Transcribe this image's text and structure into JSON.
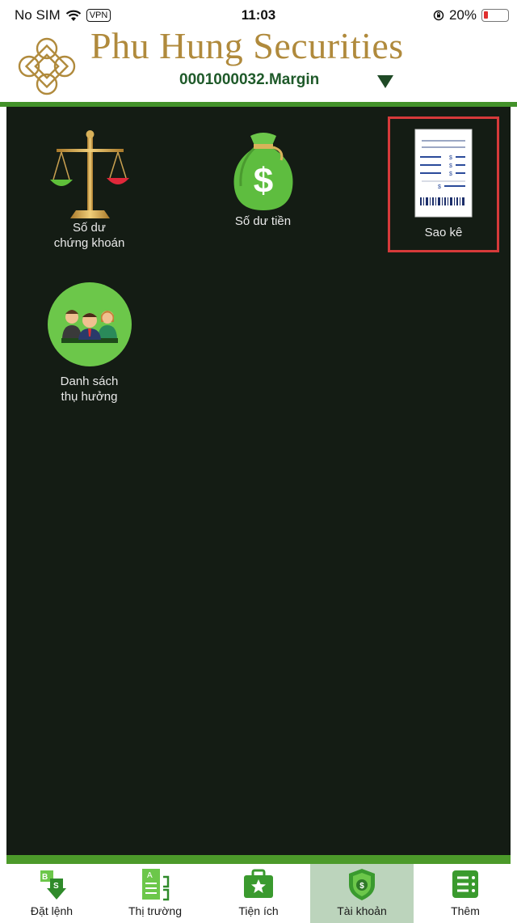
{
  "status_bar": {
    "carrier": "No SIM",
    "vpn": "VPN",
    "time": "11:03",
    "battery": "20%",
    "battery_level": 0.2
  },
  "header": {
    "brand": "Phu Hung Securities",
    "account": "0001000032.Margin"
  },
  "menu": [
    {
      "label_line1": "Số dư",
      "label_line2": "chứng khoán",
      "icon": "scales-icon"
    },
    {
      "label_line1": "Số dư tiền",
      "label_line2": "",
      "icon": "money-bag-icon"
    },
    {
      "label_line1": "Sao kê",
      "label_line2": "",
      "icon": "statement-receipt-icon",
      "highlighted": true
    },
    {
      "label_line1": "Danh sách",
      "label_line2": "thụ hưởng",
      "icon": "beneficiaries-icon"
    }
  ],
  "tabs": [
    {
      "label": "Đặt lệnh",
      "icon": "buy-sell-icon"
    },
    {
      "label": "Thị trường",
      "icon": "market-icon"
    },
    {
      "label": "Tiện ích",
      "icon": "utilities-icon"
    },
    {
      "label": "Tài khoản",
      "icon": "account-shield-icon",
      "active": true
    },
    {
      "label": "Thêm",
      "icon": "more-icon"
    }
  ],
  "colors": {
    "brand_gold": "#b08a3c",
    "brand_green": "#43922a",
    "panel": "#141c14",
    "highlight": "#d63a3a"
  }
}
